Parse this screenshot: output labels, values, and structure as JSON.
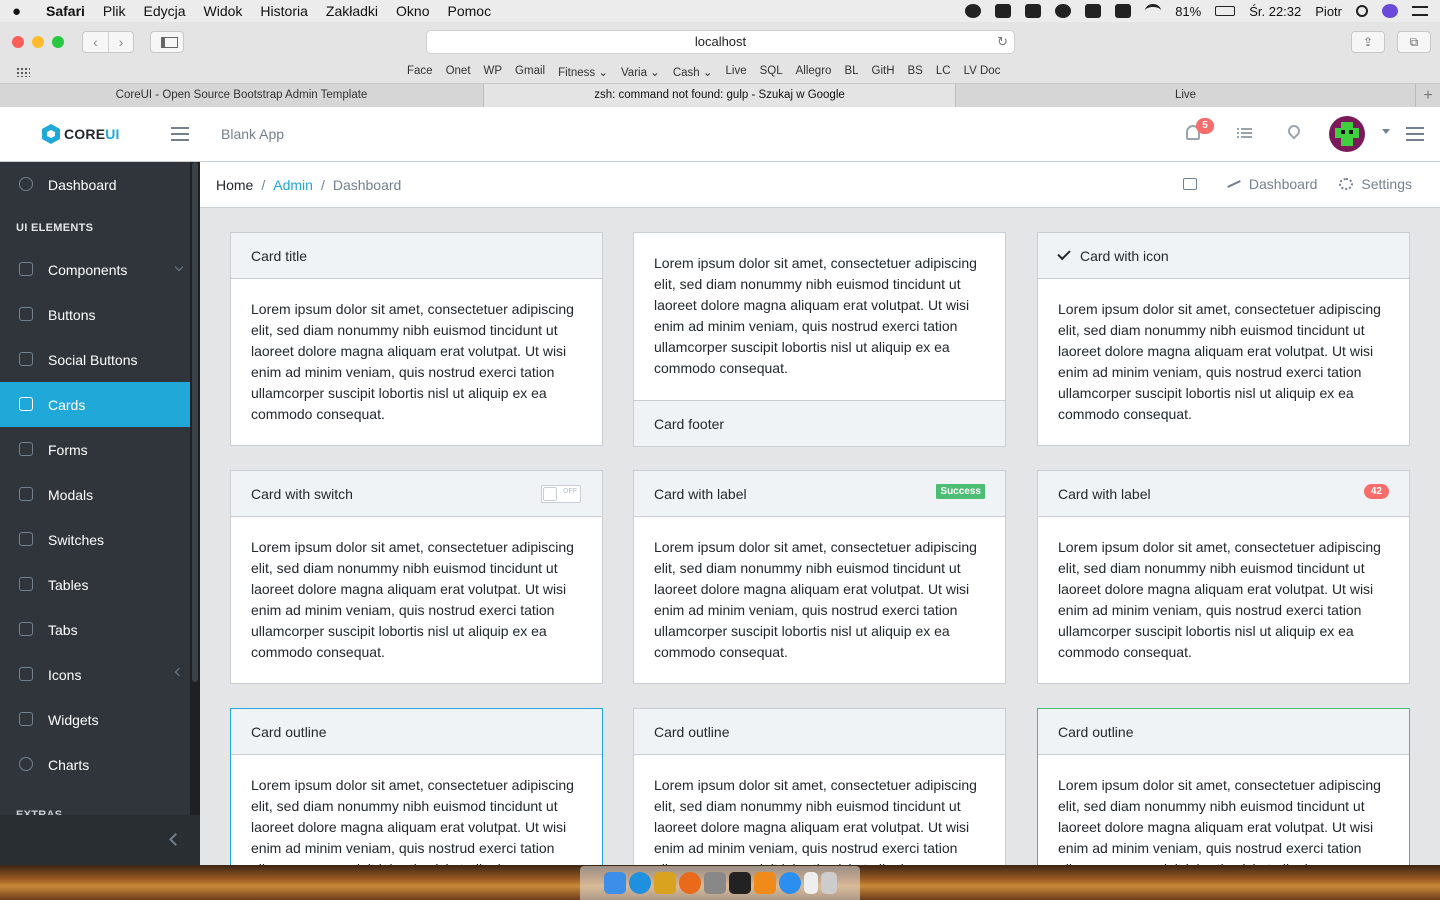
{
  "menubar": {
    "apple": "",
    "items": [
      "Safari",
      "Plik",
      "Edycja",
      "Widok",
      "Historia",
      "Zakładki",
      "Okno",
      "Pomoc"
    ],
    "battery": "81%",
    "clock": "Śr. 22:32",
    "user": "Piotr"
  },
  "browser": {
    "url": "localhost",
    "bookmarks": [
      "Face",
      "Onet",
      "WP",
      "Gmail",
      "Fitness ⌄",
      "Varia ⌄",
      "Cash ⌄",
      "Live",
      "SQL",
      "Allegro",
      "BL",
      "GitH",
      "BS",
      "LC",
      "LV Doc"
    ],
    "tabs": [
      "CoreUI - Open Source Bootstrap Admin Template",
      "zsh: command not found: gulp - Szukaj w Google",
      "Live"
    ]
  },
  "header": {
    "brand_core": "CORE",
    "brand_ui": "UI",
    "app_name": "Blank App",
    "notifications_count": "5"
  },
  "sidebar": {
    "dashboard": "Dashboard",
    "section_ui": "UI ELEMENTS",
    "items": [
      "Components",
      "Buttons",
      "Social Buttons",
      "Cards",
      "Forms",
      "Modals",
      "Switches",
      "Tables",
      "Tabs",
      "Icons",
      "Widgets",
      "Charts"
    ],
    "section_extras": "EXTRAS"
  },
  "breadcrumb": {
    "home": "Home",
    "admin": "Admin",
    "current": "Dashboard",
    "menu_dashboard": "Dashboard",
    "menu_settings": "Settings"
  },
  "lorem": "Lorem ipsum dolor sit amet, consectetuer adipiscing elit, sed diam nonummy nibh euismod tincidunt ut laoreet dolore magna aliquam erat volutpat. Ut wisi enim ad minim veniam, quis nostrud exerci tation ullamcorper suscipit lobortis nisl ut aliquip ex ea commodo consequat.",
  "cards": {
    "title": "Card title",
    "footer": "Card footer",
    "with_icon": "Card with icon",
    "with_switch": "Card with switch",
    "switch_off": "OFF",
    "with_label": "Card with label",
    "label_success": "Success",
    "label_count": "42",
    "outline": "Card outline"
  },
  "colors": {
    "primary": "#20a8d8",
    "success": "#4dbd74",
    "danger": "#f86c6b",
    "sidebar": "#2f353a"
  }
}
